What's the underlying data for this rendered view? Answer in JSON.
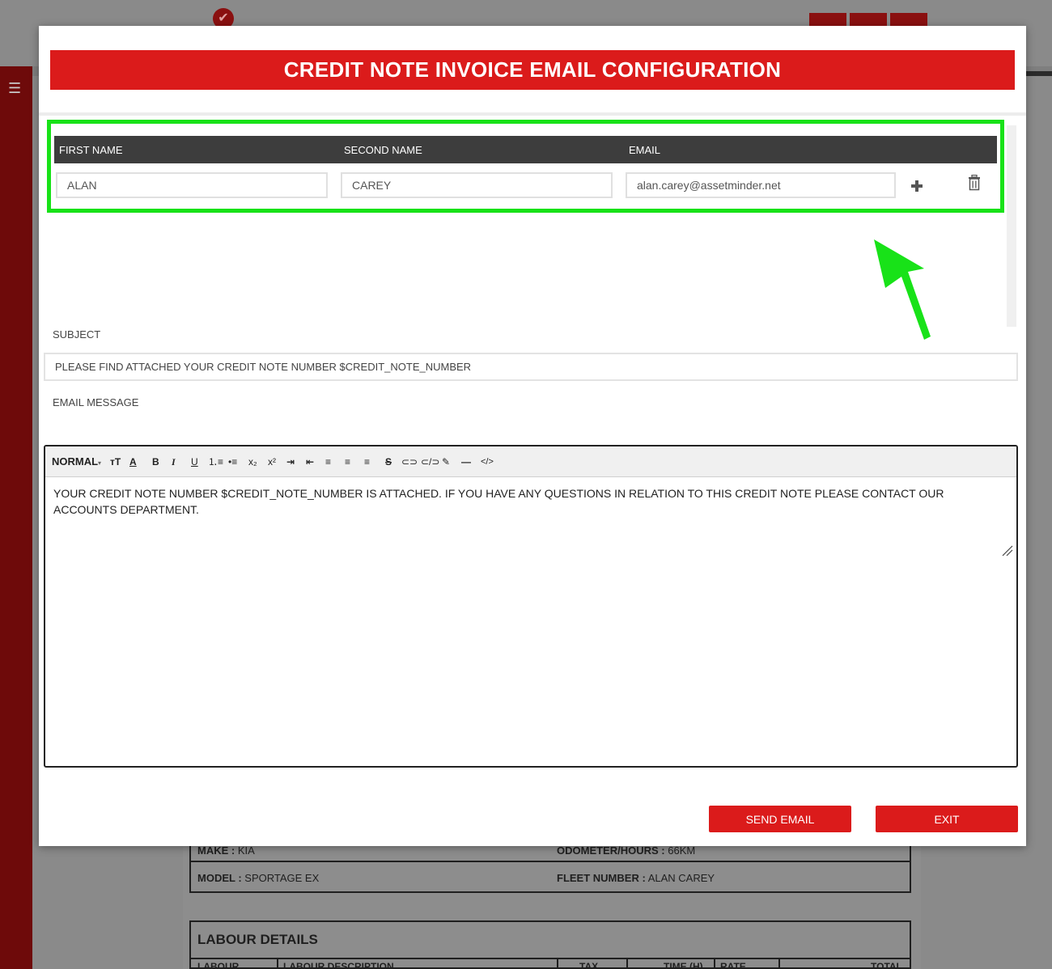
{
  "modal": {
    "title": "CREDIT NOTE INVOICE EMAIL CONFIGURATION"
  },
  "recipients": {
    "columns": [
      "FIRST NAME",
      "SECOND NAME",
      "EMAIL"
    ],
    "row": {
      "first_name": "ALAN",
      "second_name": "CAREY",
      "email": "alan.carey@assetminder.net"
    }
  },
  "subject": {
    "label": "SUBJECT",
    "value": "PLEASE FIND ATTACHED YOUR CREDIT NOTE NUMBER $CREDIT_NOTE_NUMBER"
  },
  "message": {
    "label": "EMAIL MESSAGE",
    "toolbar_style": "NORMAL",
    "body": "YOUR CREDIT NOTE NUMBER $CREDIT_NOTE_NUMBER IS ATTACHED. IF YOU HAVE ANY QUESTIONS IN RELATION TO THIS CREDIT NOTE PLEASE CONTACT OUR ACCOUNTS DEPARTMENT."
  },
  "buttons": {
    "send": "SEND EMAIL",
    "exit": "EXIT"
  },
  "background": {
    "make_label": "MAKE :",
    "make_value": "KIA",
    "odometer_label": "ODOMETER/HOURS :",
    "odometer_value": "66KM",
    "model_label": "MODEL :",
    "model_value": "SPORTAGE EX",
    "fleet_label": "FLEET NUMBER :",
    "fleet_value": "ALAN CAREY",
    "labour_title": "LABOUR DETAILS",
    "labour_cols": [
      "LABOUR",
      "LABOUR DESCRIPTION",
      "TAX",
      "TIME (H)",
      "RATE",
      "TOTAL"
    ]
  },
  "colors": {
    "brand_red": "#db1b1b",
    "highlight_green": "#18e218"
  }
}
